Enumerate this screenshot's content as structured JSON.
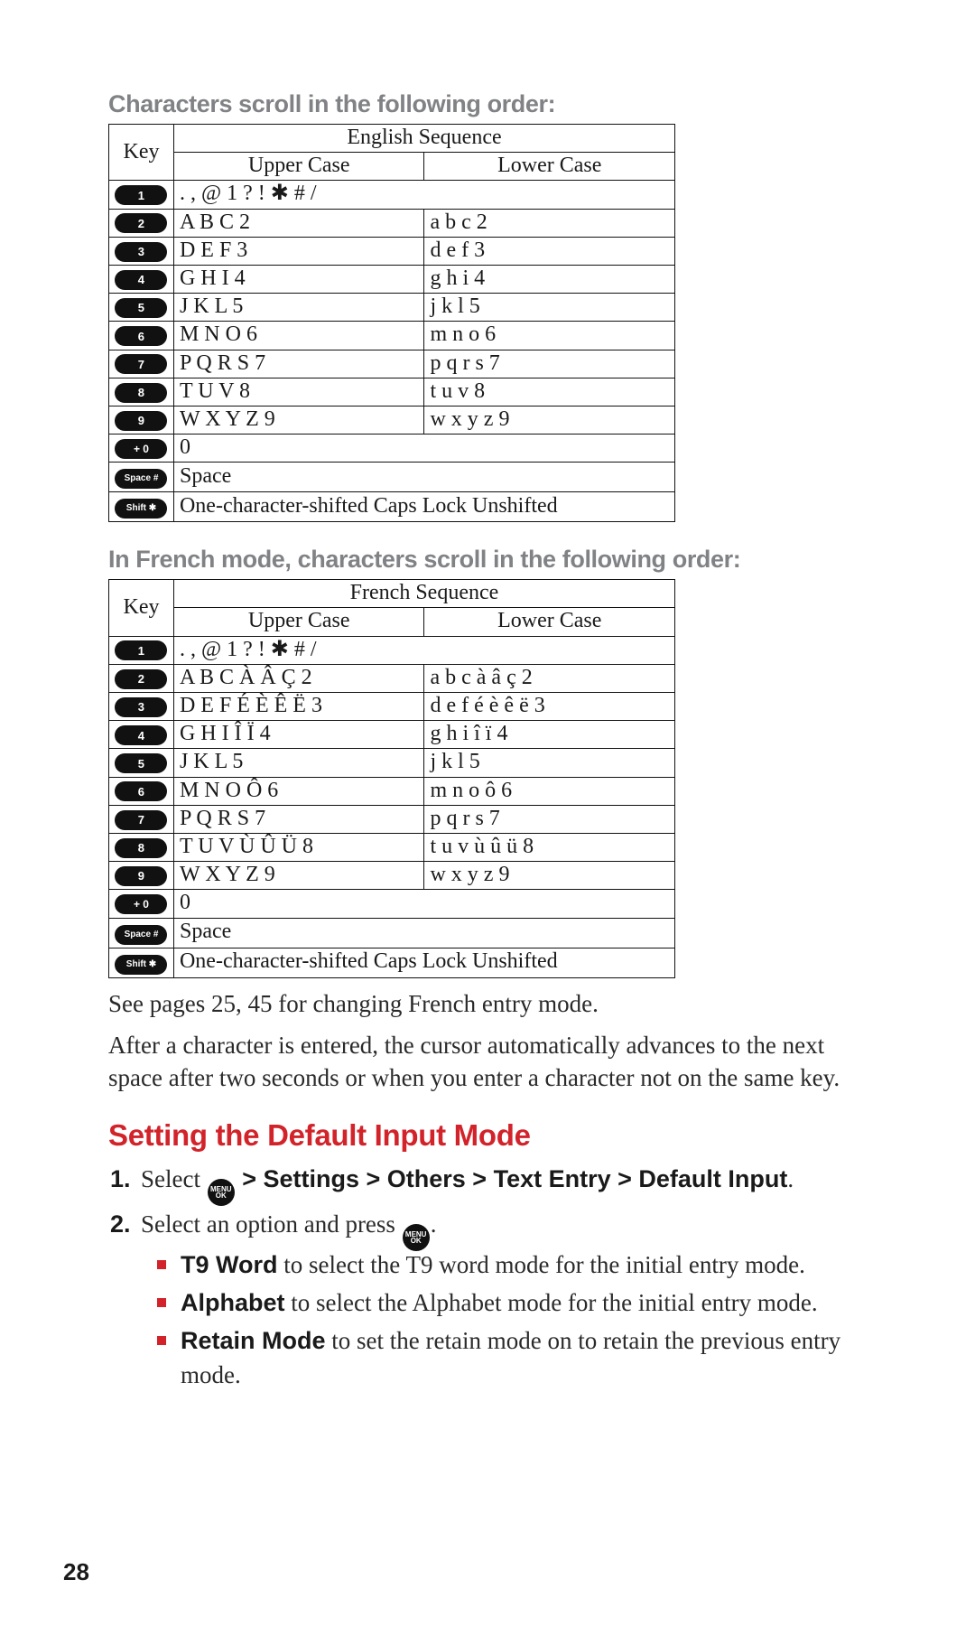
{
  "headings": {
    "english_order_title": "Characters scroll in the following order:",
    "french_order_title": "In French mode, characters scroll in the following order:",
    "section_red": "Setting the Default Input Mode"
  },
  "table_labels": {
    "key_col": "Key",
    "english_seq": "English Sequence",
    "french_seq": "French Sequence",
    "upper": "Upper Case",
    "lower": "Lower Case"
  },
  "keycaps": {
    "k1": "1",
    "k2": "2",
    "k3": "3",
    "k4": "4",
    "k5": "5",
    "k6": "6",
    "k7": "7",
    "k8": "8",
    "k9": "9",
    "plus0": "+ 0",
    "space_hash": "Space #",
    "shift_x": "Shift ✱",
    "roundkey_top": "MENU",
    "roundkey_bottom": "OK"
  },
  "english_rows": {
    "r1": {
      "full": ". , @ 1 ? ! ✱ # /"
    },
    "r2": {
      "upper": "A B C 2",
      "lower": "a b c 2"
    },
    "r3": {
      "upper": "D E F 3",
      "lower": "d e f 3"
    },
    "r4": {
      "upper": "G H I 4",
      "lower": "g h i 4"
    },
    "r5": {
      "upper": "J K L 5",
      "lower": "j k l 5"
    },
    "r6": {
      "upper": "M N O 6",
      "lower": "m n o 6"
    },
    "r7": {
      "upper": "P Q R S 7",
      "lower": "p q r s 7"
    },
    "r8": {
      "upper": "T U V 8",
      "lower": "t u v 8"
    },
    "r9": {
      "upper": "W X Y Z 9",
      "lower": "w x y z 9"
    },
    "r_plus0": {
      "full": "0"
    },
    "r_space": {
      "full": "Space"
    },
    "r_shift": {
      "full": "One-character-shifted  Caps Lock  Unshifted"
    }
  },
  "french_rows": {
    "r1": {
      "full": ". , @ 1 ? ! ✱ # /"
    },
    "r2": {
      "upper": "A B C À Â Ç 2",
      "lower": "a b c à â ç 2"
    },
    "r3": {
      "upper": "D E F É È Ê Ë 3",
      "lower": "d e f é è ê ë 3"
    },
    "r4": {
      "upper": "G H I Î Ï 4",
      "lower": "g h i î ï 4"
    },
    "r5": {
      "upper": "J K L 5",
      "lower": "j k l 5"
    },
    "r6": {
      "upper": "M N O Ô 6",
      "lower": "m n o ô 6"
    },
    "r7": {
      "upper": "P Q R S 7",
      "lower": "p q r s 7"
    },
    "r8": {
      "upper": "T U V Ù Û Ü 8",
      "lower": "t u v ù û ü 8"
    },
    "r9": {
      "upper": "W X Y Z 9",
      "lower": "w x y z 9"
    },
    "r_plus0": {
      "full": "0"
    },
    "r_space": {
      "full": "Space"
    },
    "r_shift": {
      "full": "One-character-shifted  Caps Lock  Unshifted"
    }
  },
  "body_text": {
    "see_pages": "See pages 25, 45 for changing French entry mode.",
    "after_char": "After a character is entered, the cursor automatically advances to the next space after two seconds or when you enter a character not on the same key."
  },
  "steps": {
    "s1_pre": "Select ",
    "s1_post_strong": " > Settings > Others > Text Entry > Default Input",
    "s1_period": ".",
    "s2_pre": "Select an option and press ",
    "s2_period": "."
  },
  "bullets": {
    "b1_strong": "T9 Word",
    "b1_rest": " to select the T9 word mode for the initial entry mode.",
    "b2_strong": "Alphabet",
    "b2_rest": " to select the Alphabet mode for the initial entry mode.",
    "b3_strong": "Retain Mode",
    "b3_rest": " to set the retain mode on to retain the previous entry mode."
  },
  "page_number": "28"
}
